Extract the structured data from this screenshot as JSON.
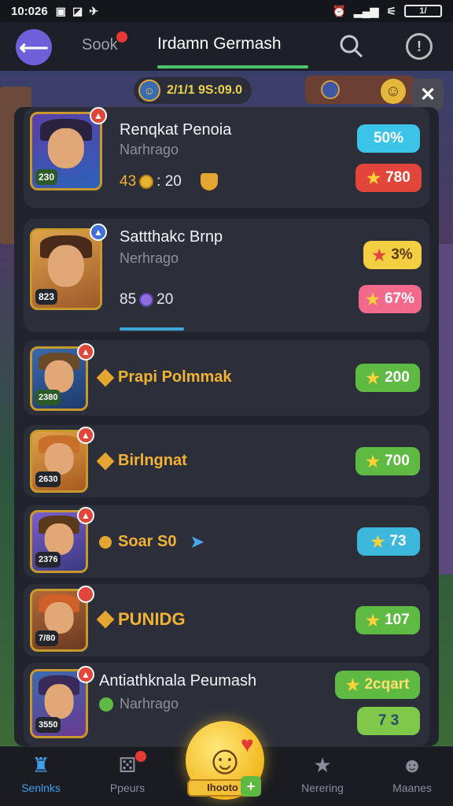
{
  "status_bar": {
    "time": "10:026",
    "battery": "1/"
  },
  "top_nav": {
    "back_icon": "arrow-left-icon",
    "tab_sook": "Sook",
    "tab_active": "Irdamn Germash",
    "search_icon": "search-icon",
    "info_icon": "info-icon"
  },
  "currency": {
    "value": "2/1/1 9S:09.0"
  },
  "cards": [
    {
      "title": "Renqkat Penoia",
      "subtitle": "Narhrago",
      "stat_value": "43",
      "stat_rest": ": 20",
      "portrait_tag": "230",
      "pill_top": "50%",
      "pill_bottom": "780",
      "accent": "#e2463a"
    },
    {
      "title": "Sattthakc Brnp",
      "subtitle": "Nerhrago",
      "stat_value": "85",
      "stat_rest": "20",
      "portrait_tag": "823",
      "pill_top": "3%",
      "pill_bottom": "67%",
      "accent": "#f3698c"
    },
    {
      "title": "Prapi Polmmak",
      "portrait_tag": "2380",
      "pill": "200"
    },
    {
      "title": "Birlngnat",
      "portrait_tag": "2630",
      "pill": "700"
    },
    {
      "title": "Soar S0",
      "portrait_tag": "2376",
      "pill": "73"
    },
    {
      "title": "PUNIDG",
      "portrait_tag": "7/80",
      "pill": "107"
    },
    {
      "title": "Antiathknala Peumash",
      "subtitle": "Narhrago",
      "portrait_tag": "3550",
      "pill_top": "2cqart",
      "pill_bottom": "7 3"
    }
  ],
  "bottom_nav": {
    "items": [
      {
        "label": "Senlnks",
        "icon": "castle-icon"
      },
      {
        "label": "Ppeurs",
        "icon": "dice-icon"
      },
      {
        "label": "Nerering",
        "icon": "star-icon"
      },
      {
        "label": "Maanes",
        "icon": "people-icon"
      }
    ],
    "center_label": "Ihooto",
    "center_icon": "smile-emoji-icon"
  }
}
